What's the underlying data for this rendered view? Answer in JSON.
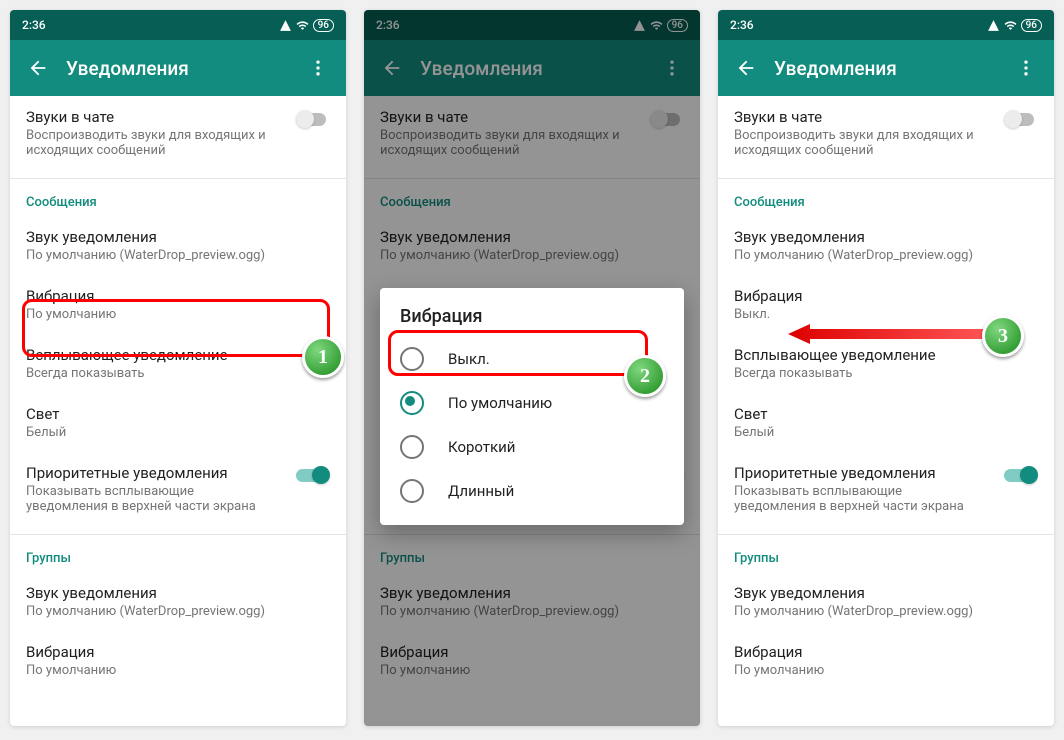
{
  "statusbar": {
    "time": "2:36",
    "battery": "96"
  },
  "appbar": {
    "title": "Уведомления"
  },
  "chatSounds": {
    "title": "Звуки в чате",
    "sub": "Воспроизводить звуки для входящих и исходящих сообщений"
  },
  "messages": {
    "header": "Сообщения",
    "sound": {
      "title": "Звук уведомления",
      "sub": "По умолчанию (WaterDrop_preview.ogg)"
    },
    "vibration": {
      "title": "Вибрация",
      "sub_default": "По умолчанию",
      "sub_off": "Выкл."
    },
    "popup": {
      "title": "Всплывающее уведомление",
      "sub": "Всегда показывать"
    },
    "light": {
      "title": "Свет",
      "sub": "Белый"
    },
    "priority": {
      "title": "Приоритетные уведомления",
      "sub": "Показывать всплывающие уведомления в верхней части экрана"
    }
  },
  "groups": {
    "header": "Группы",
    "sound": {
      "title": "Звук уведомления",
      "sub": "По умолчанию (WaterDrop_preview.ogg)"
    },
    "vibration": {
      "title": "Вибрация",
      "sub": "По умолчанию"
    }
  },
  "dialog": {
    "title": "Вибрация",
    "options": {
      "off": "Выкл.",
      "default": "По умолчанию",
      "short": "Короткий",
      "long": "Длинный"
    }
  },
  "markers": {
    "m1": "1",
    "m2": "2",
    "m3": "3"
  }
}
